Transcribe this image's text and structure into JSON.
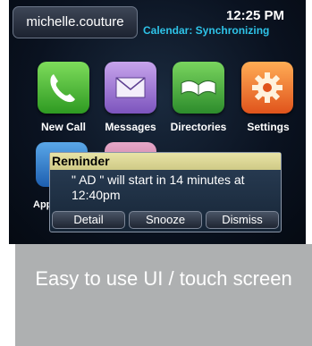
{
  "status_bar": {
    "username": "michelle.couture",
    "time": "12:25 PM",
    "calendar_status": "Calendar: Synchronizing"
  },
  "apps": [
    {
      "label": "New Call",
      "icon": "phone-icon"
    },
    {
      "label": "Messages",
      "icon": "envelope-icon"
    },
    {
      "label": "Directories",
      "icon": "book-icon"
    },
    {
      "label": "Settings",
      "icon": "gear-icon"
    }
  ],
  "apps_row2_partial_label": "App",
  "reminder": {
    "title": "Reminder",
    "message": "\" AD \" will start in 14 minutes at 12:40pm",
    "buttons": [
      "Detail",
      "Snooze",
      "Dismiss"
    ]
  },
  "caption": "Easy to use UI / touch screen",
  "colors": {
    "accent_cyan": "#2ec3e8",
    "reminder_header": "#dcd89a",
    "caption_bg": "#aeb0b1"
  }
}
